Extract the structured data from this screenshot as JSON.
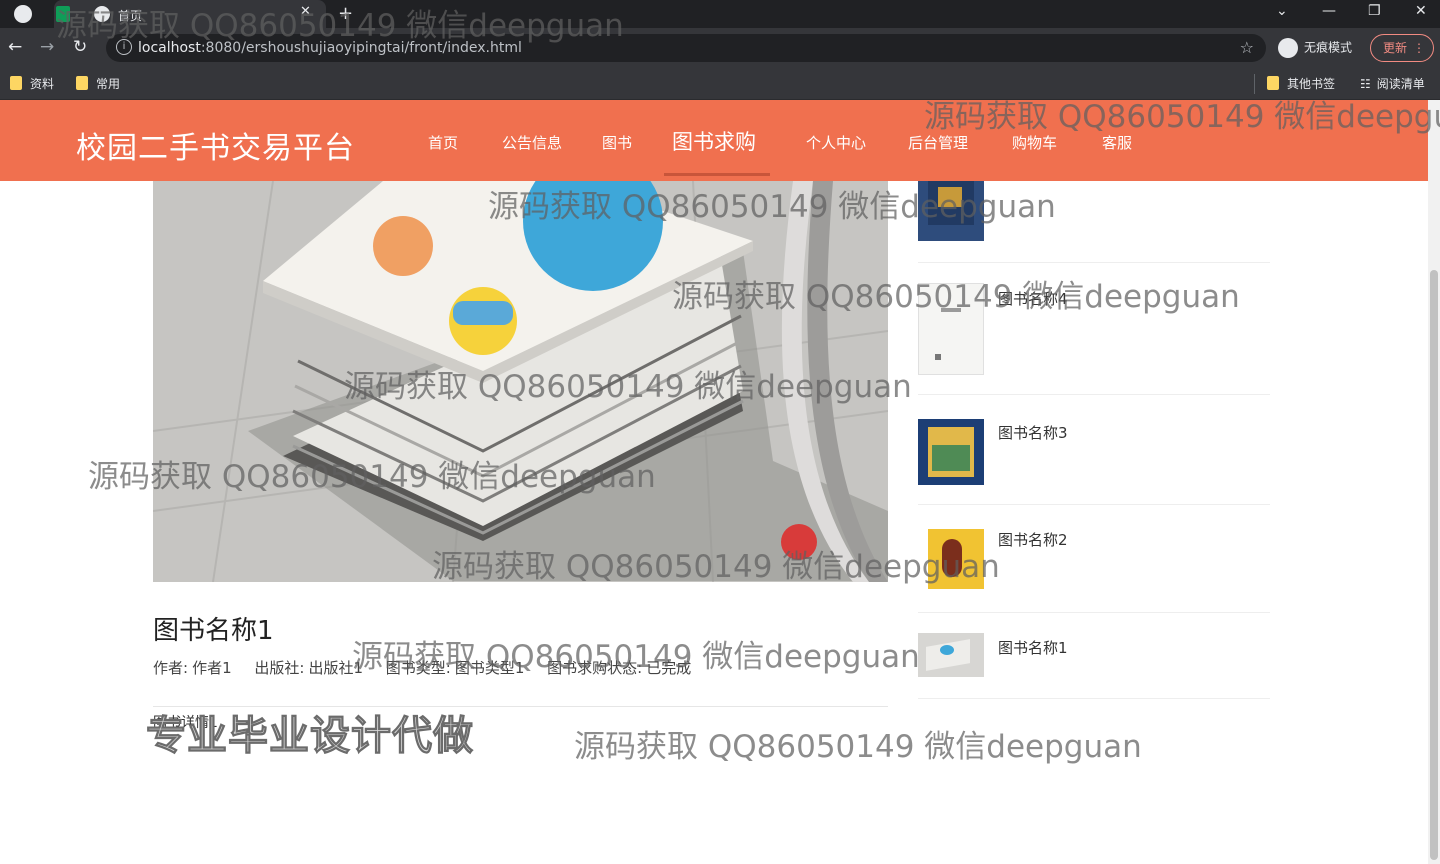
{
  "browser": {
    "tab_title": "首页",
    "url_host": "localhost",
    "url_rest": ":8080/ershoushujiaoyipingtai/front/index.html",
    "incognito_label": "无痕模式",
    "update_label": "更新",
    "bookmarks": [
      "资料",
      "常用"
    ],
    "bookmarks_right": [
      "其他书签",
      "阅读清单"
    ],
    "icons": {
      "back": "←",
      "forward": "→",
      "reload": "↻",
      "star": "☆",
      "close": "✕",
      "new_tab": "+",
      "minimize": "—",
      "restore": "❐",
      "chevron": "⌄",
      "menu": "⋮",
      "reading_list": "☷",
      "info": "i"
    }
  },
  "site": {
    "title": "校园二手书交易平台",
    "nav": [
      "首页",
      "公告信息",
      "图书",
      "图书求购",
      "个人中心",
      "后台管理",
      "购物车",
      "客服"
    ],
    "active_nav_index": 3,
    "header_color": "#f0704f"
  },
  "book": {
    "name": "图书名称1",
    "author_label": "作者:",
    "author": "作者1",
    "publisher_label": "出版社:",
    "publisher": "出版社1",
    "type_label": "图书类型:",
    "type": "图书类型1",
    "status_label": "图书求购状态:",
    "status": "已完成",
    "details_label": "图书详情1"
  },
  "sidebar": {
    "items": [
      {
        "label": ""
      },
      {
        "label": "图书名称4"
      },
      {
        "label": "图书名称3"
      },
      {
        "label": "图书名称2"
      },
      {
        "label": "图书名称1"
      }
    ]
  },
  "overlay": {
    "watermark": "源码获取 QQ86050149 微信deepguan",
    "promo": "专业毕业设计代做"
  }
}
